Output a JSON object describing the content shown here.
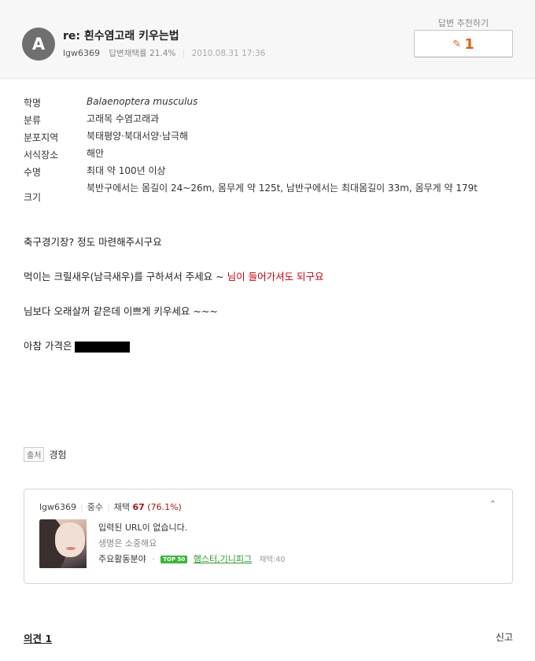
{
  "answer": {
    "avatar_letter": "A",
    "title": "re: 흰수염고래 키우는법",
    "author": "lgw6369",
    "adoption_label": "답변채택률 21.4%",
    "date": "2010.08.31 17:36"
  },
  "recommend": {
    "label": "답변 추천하기",
    "icon": "thumbs-up-icon",
    "count": "1"
  },
  "info_table": [
    {
      "key": "학명",
      "value": "Balaenoptera musculus"
    },
    {
      "key": "분류",
      "value": "고래목 수염고래과"
    },
    {
      "key": "분포지역",
      "value": "북태평양·북대서양·남극해"
    },
    {
      "key": "서식장소",
      "value": "해안"
    },
    {
      "key": "수명",
      "value": "최대 약 100년 이상"
    },
    {
      "key": "크기",
      "value": "북반구에서는 몸길이 24~26m, 몸무게 약 125t, 남반구에서는 최대몸길이 33m, 몸무게 약 179t"
    }
  ],
  "paragraphs": {
    "p1": "축구경기장? 정도 마련해주시구요",
    "p2_prefix": "먹이는 크릴새우(남극새우)를 구하셔서 주세요 ~ ",
    "p2_red": "님이 들어가셔도 되구요",
    "p3": "님보다 오래살꺼 같은데 이쁘게 키우세요 ~~~",
    "p4": "아참 가격은"
  },
  "source": {
    "tag": "출처",
    "value": "경험"
  },
  "profile": {
    "username": "lgw6369",
    "rank": "중수",
    "adopt_label": "채택",
    "adopt_count": "67",
    "adopt_pct": "(76.1%)",
    "url_text": "입력된 URL이 없습니다.",
    "motto": "생명은 소중해요",
    "area_label": "주요활동분야",
    "badge": "TOP 50",
    "area_value": "햄스터,기니피그",
    "area_count": "채택:40",
    "collapse_icon": "chevron-up-icon"
  },
  "footer": {
    "comments": "의견 1",
    "report": "신고"
  }
}
